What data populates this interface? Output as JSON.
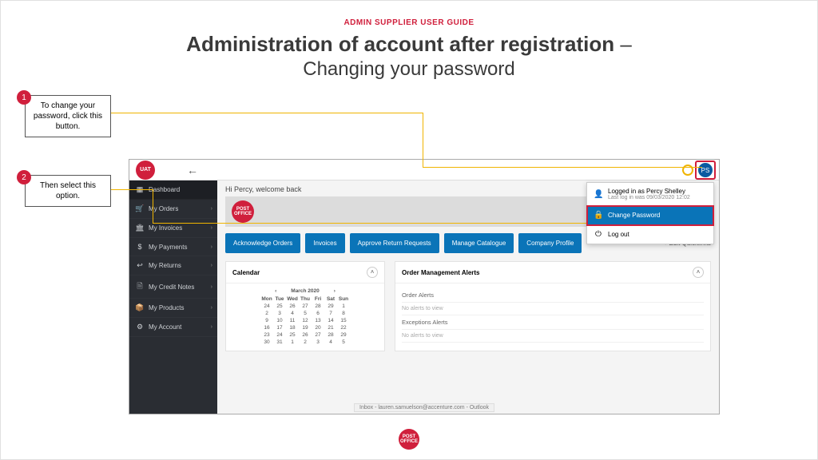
{
  "doc": {
    "header": "ADMIN SUPPLIER USER GUIDE",
    "title_main": "Administration of account after registration",
    "title_dash": " – ",
    "title_sub": "Changing your password"
  },
  "callouts": {
    "c1": {
      "num": "1",
      "text": "To change your password, click this button."
    },
    "c2": {
      "num": "2",
      "text": "Then select this option."
    }
  },
  "app": {
    "logo_uat": "UAT",
    "logo_po": "POST OFFICE",
    "back": "←",
    "avatar": "PS",
    "welcome": "Hi Percy, welcome back",
    "sidebar": {
      "items": [
        {
          "icon": "▦",
          "label": "Dashboard"
        },
        {
          "icon": "🛒",
          "label": "My Orders"
        },
        {
          "icon": "🏛",
          "label": "My Invoices"
        },
        {
          "icon": "$",
          "label": "My Payments"
        },
        {
          "icon": "↩",
          "label": "My Returns"
        },
        {
          "icon": "🗎",
          "label": "My Credit Notes"
        },
        {
          "icon": "📦",
          "label": "My Products"
        },
        {
          "icon": "⚙",
          "label": "My Account"
        }
      ]
    },
    "quicklinks": {
      "items": [
        "Acknowledge Orders",
        "Invoices",
        "Approve Return Requests",
        "Manage Catalogue",
        "Company Profile"
      ],
      "edit": "Edit Quicklinks"
    },
    "calendar": {
      "title": "Calendar",
      "month": "March 2020",
      "days": [
        "Mon",
        "Tue",
        "Wed",
        "Thu",
        "Fri",
        "Sat",
        "Sun"
      ],
      "rows": [
        [
          "24",
          "25",
          "26",
          "27",
          "28",
          "29",
          "1"
        ],
        [
          "2",
          "3",
          "4",
          "5",
          "6",
          "7",
          "8"
        ],
        [
          "9",
          "10",
          "11",
          "12",
          "13",
          "14",
          "15"
        ],
        [
          "16",
          "17",
          "18",
          "19",
          "20",
          "21",
          "22"
        ],
        [
          "23",
          "24",
          "25",
          "26",
          "27",
          "28",
          "29"
        ],
        [
          "30",
          "31",
          "1",
          "2",
          "3",
          "4",
          "5"
        ]
      ]
    },
    "alerts": {
      "title": "Order Management Alerts",
      "r1": "Order Alerts",
      "r1m": "No alerts to view",
      "r2": "Exceptions Alerts",
      "r2m": "No alerts to view"
    },
    "user_menu": {
      "logged": "Logged in as Percy Shelley",
      "last": "Last log in was 09/03/2020 12:02",
      "change": "Change Password",
      "logout": "Log out"
    },
    "footer_pill": "Inbox - lauren.samuelson@accenture.com - Outlook"
  }
}
